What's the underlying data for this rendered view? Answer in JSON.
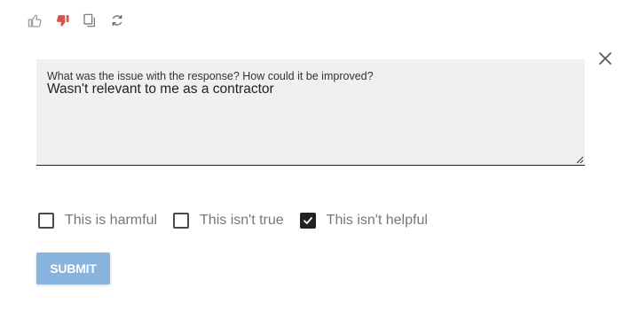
{
  "feedback_icons": {
    "thumbs_up": {
      "icon": "thumbs-up-icon",
      "color": "#9e9e9e"
    },
    "thumbs_down": {
      "icon": "thumbs-down-icon",
      "color": "#d9534f"
    },
    "copy": {
      "icon": "copy-icon",
      "color": "#6e6e6e"
    },
    "regenerate": {
      "icon": "regenerate-icon",
      "color": "#6e6e6e"
    }
  },
  "close": {
    "icon": "close-icon",
    "color": "#555555"
  },
  "feedback_form": {
    "label": "What was the issue with the response? How could it be improved?",
    "value": "Wasn't relevant to me as a contractor",
    "background": "#f0f0f0"
  },
  "options": [
    {
      "label": "This is harmful",
      "checked": false
    },
    {
      "label": "This isn't true",
      "checked": false
    },
    {
      "label": "This isn't helpful",
      "checked": true
    }
  ],
  "submit": {
    "label": "SUBMIT",
    "color": "#88b3de"
  }
}
